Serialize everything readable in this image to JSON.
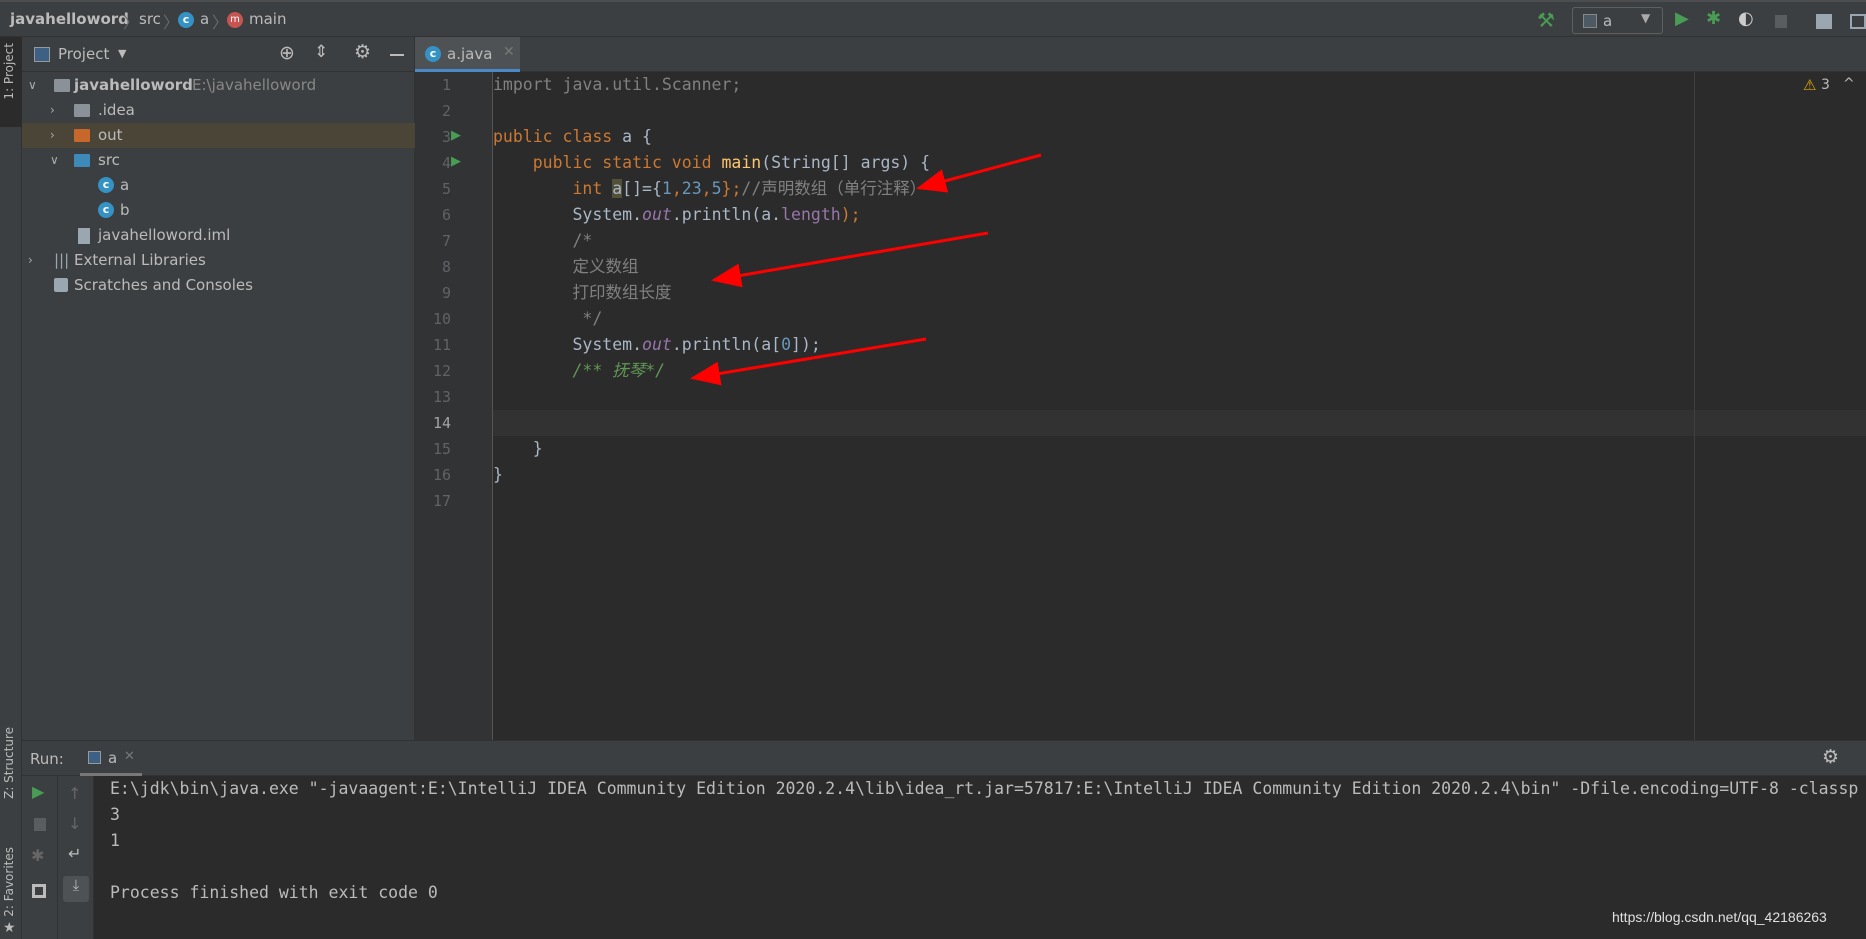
{
  "breadcrumb": {
    "project": "javahelloword",
    "src": "src",
    "class": "a",
    "method": "main"
  },
  "toolbar": {
    "run_config": "a",
    "warning_count": "3"
  },
  "side_tabs": {
    "project": "1: Project",
    "structure": "Z: Structure",
    "favorites": "2: Favorites"
  },
  "project_panel": {
    "title": "Project",
    "tree": [
      {
        "label": "javahelloword",
        "path": "E:\\javahelloword"
      },
      {
        "label": ".idea"
      },
      {
        "label": "out"
      },
      {
        "label": "src"
      },
      {
        "label": "a"
      },
      {
        "label": "b"
      },
      {
        "label": "javahelloword.iml"
      },
      {
        "label": "External Libraries"
      },
      {
        "label": "Scratches and Consoles"
      }
    ]
  },
  "editor": {
    "tab": "a.java",
    "lines": [
      "1",
      "2",
      "3",
      "4",
      "5",
      "6",
      "7",
      "8",
      "9",
      "10",
      "11",
      "12",
      "13",
      "14",
      "15",
      "16",
      "17"
    ],
    "code": {
      "l1": "import java.util.Scanner;",
      "l3a": "public class ",
      "l3b": "a {",
      "l4a": "    public static void ",
      "l4b": "main",
      "l4c": "(String[] args) {",
      "l5a": "        int ",
      "l5b": "a",
      "l5c": "[]={",
      "l5d": "1",
      "l5e": ",",
      "l5f": "23",
      "l5g": ",",
      "l5h": "5",
      "l5i": "};",
      "l5j": "//声明数组（单行注释）",
      "l6a": "        System.",
      "l6b": "out",
      "l6c": ".println(a.",
      "l6d": "length",
      "l6e": ");",
      "l7": "        /*",
      "l8": "        定义数组",
      "l9": "        打印数组长度",
      "l10": "         */",
      "l11a": "        System.",
      "l11b": "out",
      "l11c": ".println(a[",
      "l11d": "0",
      "l11e": "]);",
      "l12": "        /** 抚琴*/",
      "l15": "    }",
      "l16": "}"
    }
  },
  "run": {
    "label": "Run:",
    "tab": "a",
    "output": [
      "E:\\jdk\\bin\\java.exe \"-javaagent:E:\\IntelliJ IDEA Community Edition 2020.2.4\\lib\\idea_rt.jar=57817:E:\\IntelliJ IDEA Community Edition 2020.2.4\\bin\" -Dfile.encoding=UTF-8 -classp",
      "3",
      "1",
      "",
      "Process finished with exit code 0"
    ]
  },
  "watermark": "https://blog.csdn.net/qq_42186263",
  "colors": {
    "accent": "#4a88c7",
    "annotation_arrow": "#ff0000",
    "keyword": "#cc7832",
    "number": "#6897bb"
  }
}
